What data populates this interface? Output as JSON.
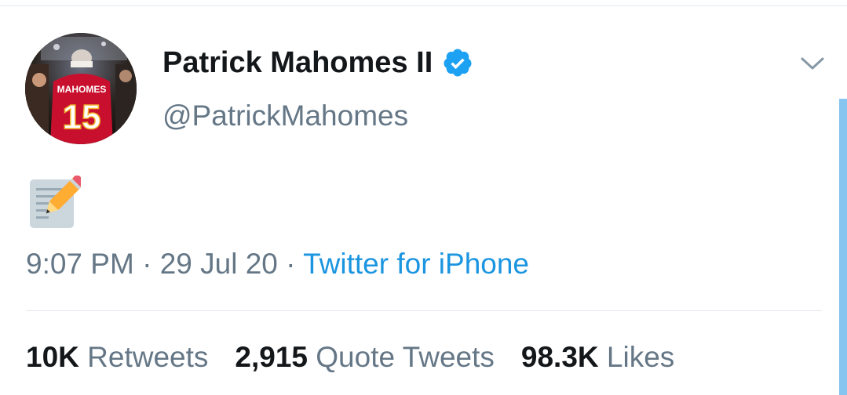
{
  "tweet": {
    "display_name": "Patrick Mahomes II",
    "handle": "@PatrickMahomes",
    "verified": true,
    "body_emoji": "memo-icon",
    "time": "9:07 PM",
    "date": "29 Jul 20",
    "separator": "·",
    "source": "Twitter for iPhone"
  },
  "stats": [
    {
      "count": "10K",
      "label": "Retweets"
    },
    {
      "count": "2,915",
      "label": "Quote Tweets"
    },
    {
      "count": "98.3K",
      "label": "Likes"
    }
  ],
  "colors": {
    "name": "#14171a",
    "secondary": "#657786",
    "link": "#1b95e0",
    "verified": "#1da1f2",
    "divider": "#e1e8ed"
  }
}
